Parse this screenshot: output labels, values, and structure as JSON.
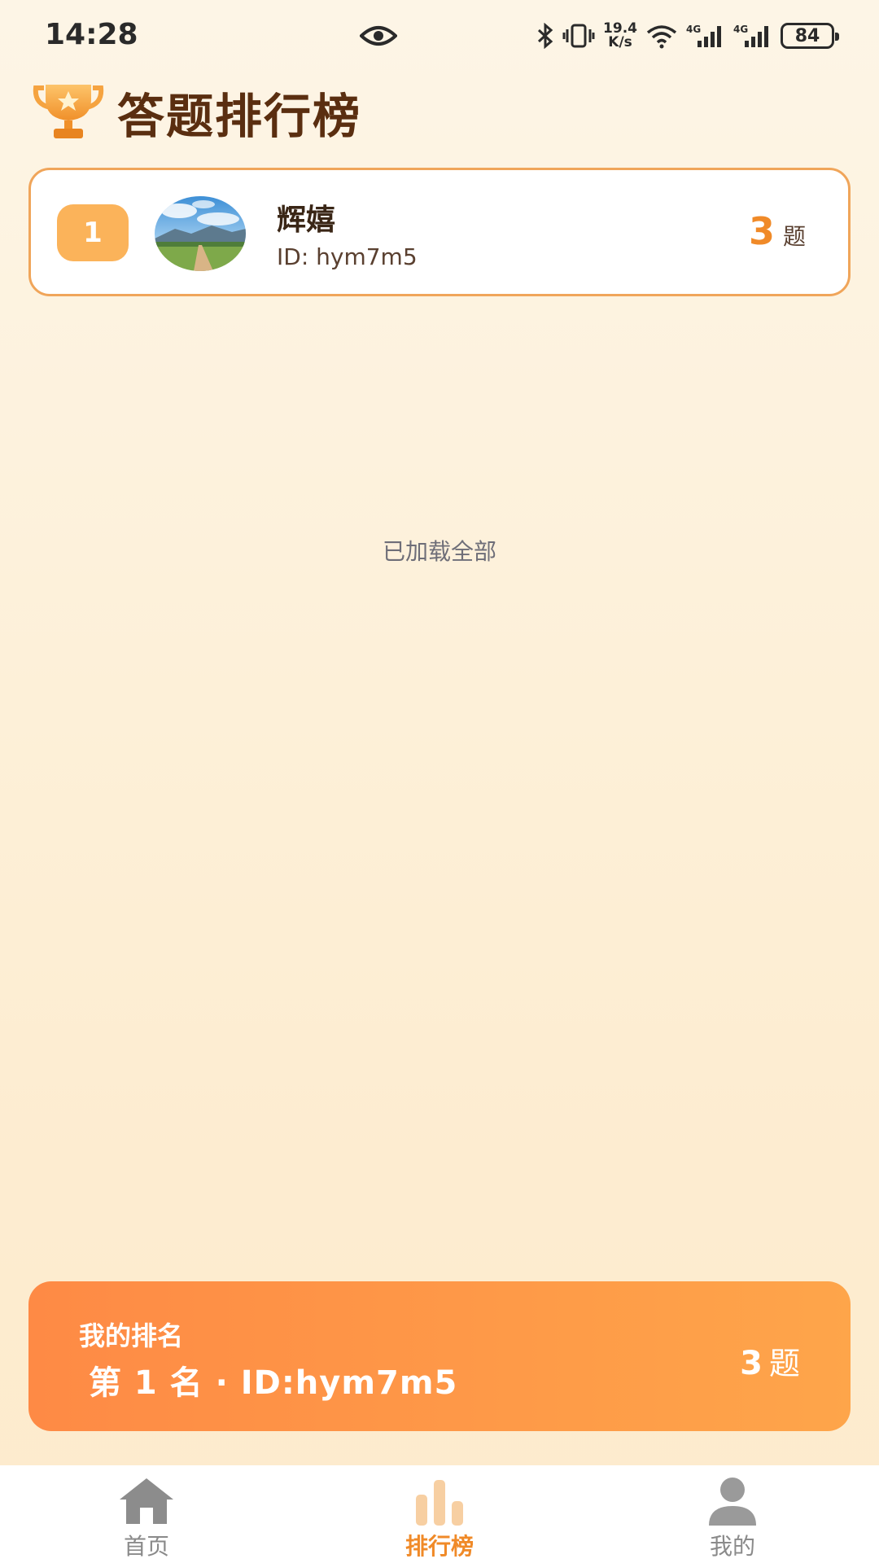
{
  "status_bar": {
    "time": "14:28",
    "net_speed_value": "19.4",
    "net_speed_unit": "K/s",
    "battery": "84",
    "icons": [
      "eye-icon",
      "bluetooth-icon",
      "vibrate-icon",
      "wifi-icon",
      "signal-4g-icon",
      "signal-4g-icon",
      "battery-icon"
    ]
  },
  "header": {
    "title": "答题排行榜",
    "icon": "trophy-icon"
  },
  "leaderboard": [
    {
      "rank": "1",
      "name": "辉嬉",
      "id": "ID: hym7m5",
      "score": "3",
      "unit": "题"
    }
  ],
  "list_footer": "已加载全部",
  "my_rank": {
    "label": "我的排名",
    "detail": "第 1 名 · ID:hym7m5",
    "score": "3",
    "unit": "题"
  },
  "nav": {
    "home": "首页",
    "rank": "排行榜",
    "mine": "我的",
    "active": "rank"
  },
  "colors": {
    "accent": "#f08a28",
    "badge": "#fbb35a",
    "title": "#5a2e10",
    "banner_start": "#fe8a45",
    "banner_end": "#fea54a"
  }
}
